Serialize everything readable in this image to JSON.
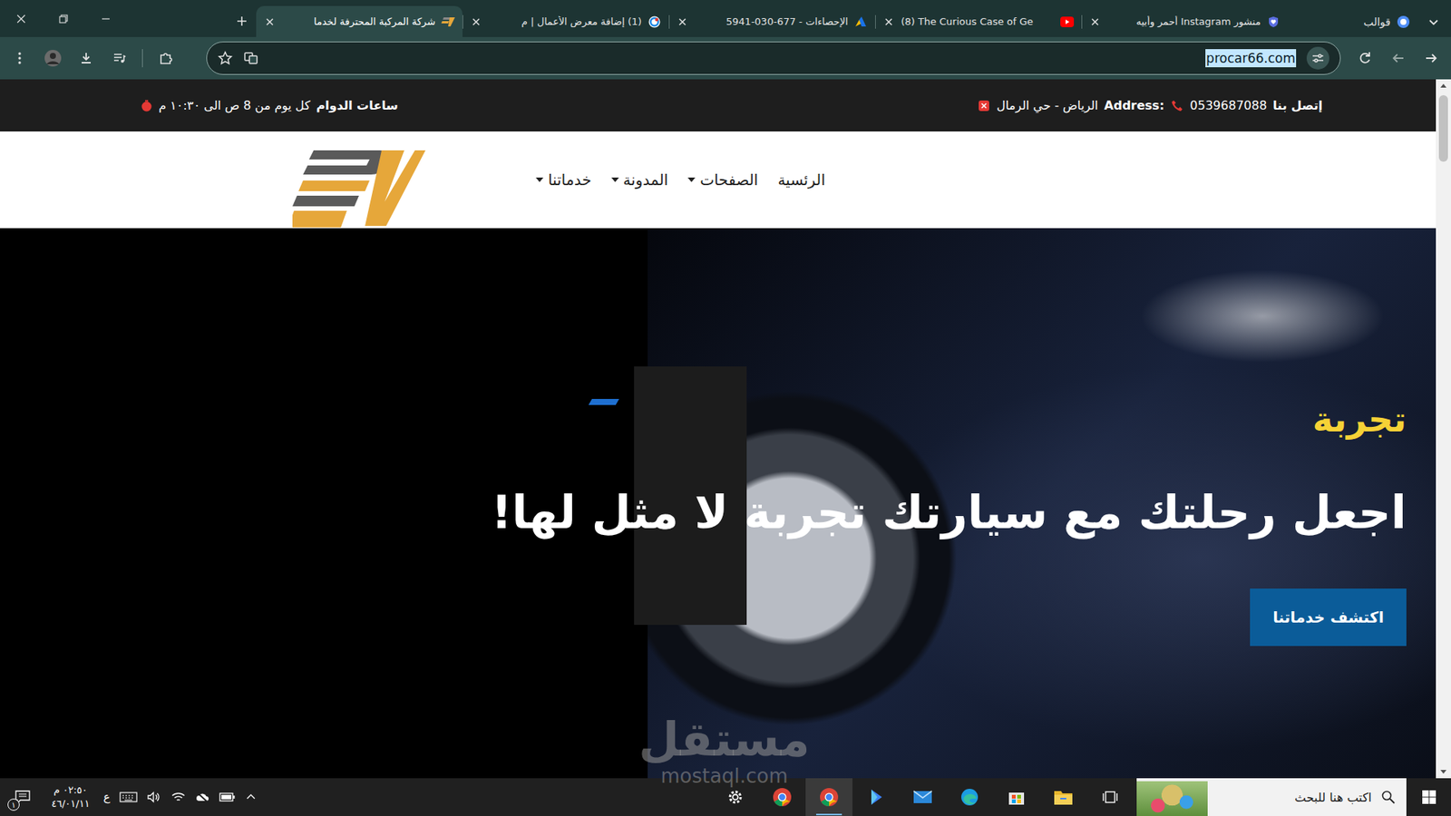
{
  "browser": {
    "tab_group": "قوالب",
    "tabs": [
      {
        "title": "منشور Instagram أحمر وأبيه",
        "selected": false
      },
      {
        "title": "(8) The Curious Case of Ge",
        "selected": false
      },
      {
        "title": "الإحصاءات - 677-030-5941",
        "selected": false
      },
      {
        "title": "(1) إضافة معرض الأعمال | م",
        "selected": false
      },
      {
        "title": "شركة المركبة المحترفة لخدما",
        "selected": true
      }
    ],
    "address": "procar66.com",
    "address_selected": true
  },
  "site": {
    "topbar": {
      "contact_label": "إتصل بنا",
      "phone": "0539687088",
      "address_label": "Address:",
      "address": "الرياض - حي الرمال",
      "hours_label": "ساعات الدوام",
      "hours": "كل يوم من 8 ص الى ١٠:٣٠ م"
    },
    "nav": [
      {
        "label": "الرئسية",
        "dropdown": false
      },
      {
        "label": "الصفحات",
        "dropdown": true
      },
      {
        "label": "المدونة",
        "dropdown": true
      },
      {
        "label": "خدماتنا",
        "dropdown": true
      }
    ],
    "hero": {
      "kicker": "تجربة",
      "heading": "اجعل رحلتك مع سيارتك تجربة لا مثل لها!",
      "button": "اكتشف خدماتنا"
    }
  },
  "watermark": {
    "arabic": "مستقل",
    "latin": "mostaql.com"
  },
  "taskbar": {
    "search_placeholder": "اكتب هنا للبحث",
    "apps": [
      {
        "active": false
      },
      {
        "active": false
      },
      {
        "active": false
      },
      {
        "active": false
      },
      {
        "active": false
      },
      {
        "active": false
      },
      {
        "active": true
      },
      {
        "active": false
      },
      {
        "active": false
      }
    ],
    "language": "ع",
    "time": "٠٢:٥٠ م",
    "date": "٤٦/٠١/١١",
    "notifications": "١"
  }
}
